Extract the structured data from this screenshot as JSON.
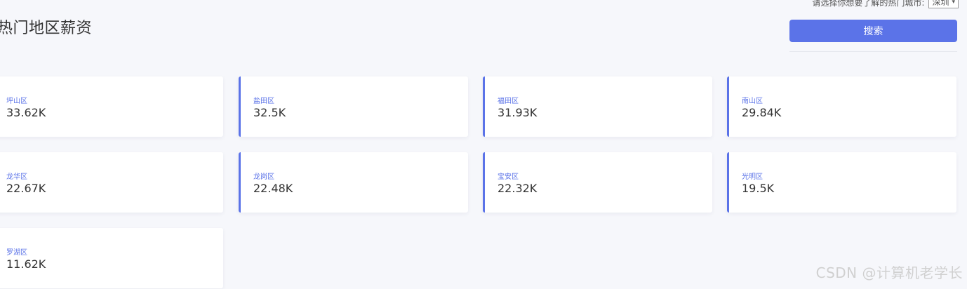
{
  "header": {
    "title": "热门地区薪资",
    "city_prompt": "请选择你想要了解的热门城市:",
    "city_value": "深圳",
    "search_label": "搜索"
  },
  "cards": [
    {
      "district": "坪山区",
      "salary": "33.62K"
    },
    {
      "district": "盐田区",
      "salary": "32.5K"
    },
    {
      "district": "福田区",
      "salary": "31.93K"
    },
    {
      "district": "南山区",
      "salary": "29.84K"
    },
    {
      "district": "龙华区",
      "salary": "22.67K"
    },
    {
      "district": "龙岗区",
      "salary": "22.48K"
    },
    {
      "district": "宝安区",
      "salary": "22.32K"
    },
    {
      "district": "光明区",
      "salary": "19.5K"
    },
    {
      "district": "罗湖区",
      "salary": "11.62K"
    }
  ],
  "watermark": "CSDN @计算机老学长",
  "colors": {
    "accent": "#5b73e8",
    "background": "#f6f7fb"
  }
}
